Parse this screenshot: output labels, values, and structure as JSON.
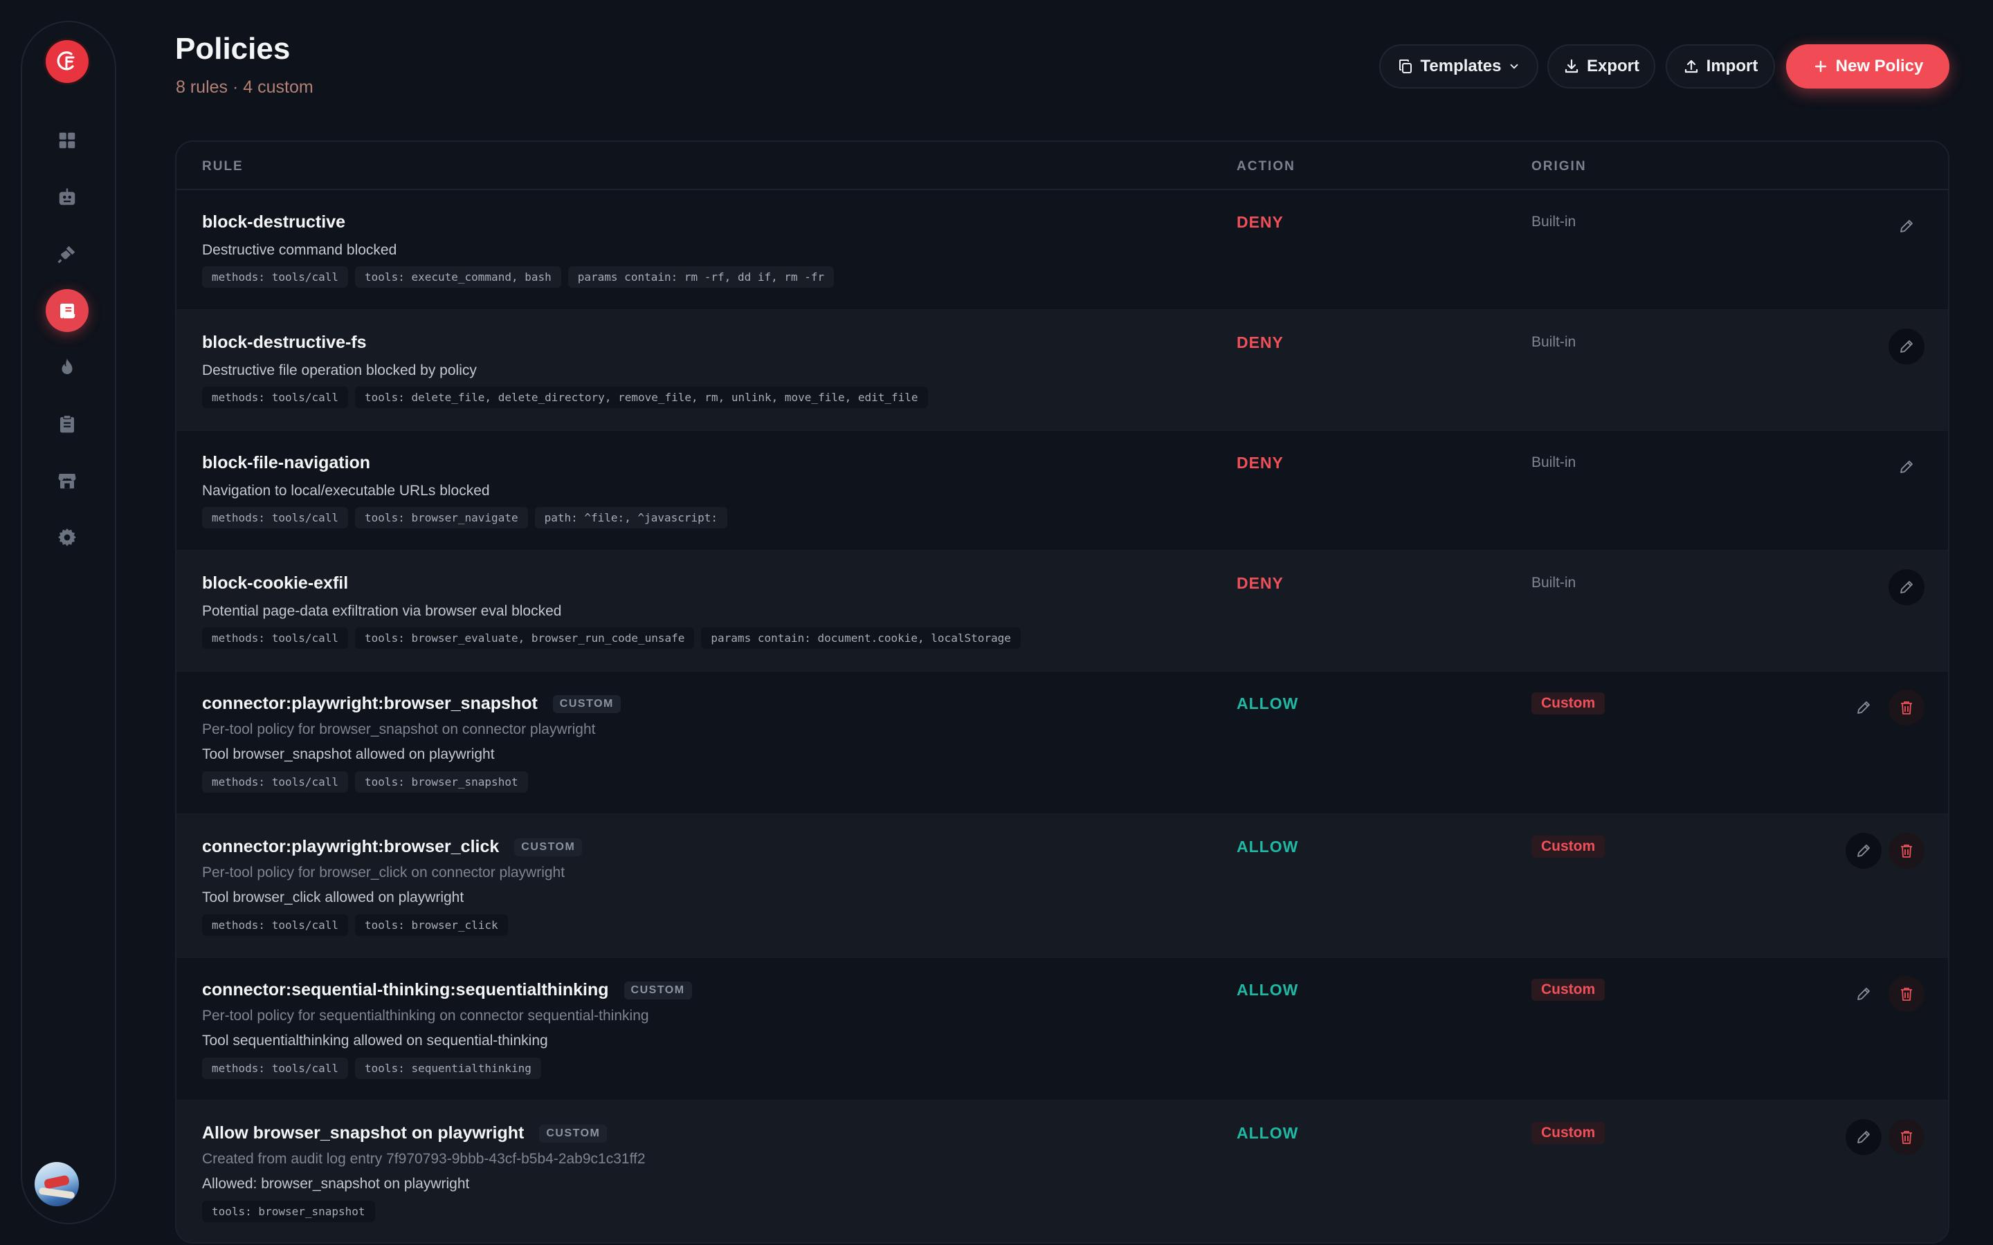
{
  "header": {
    "title": "Policies",
    "subtitle": "8 rules · 4 custom",
    "templates_label": "Templates",
    "export_label": "Export",
    "import_label": "Import",
    "new_policy_label": "New Policy"
  },
  "sidebar": {
    "items": [
      {
        "name": "dashboard",
        "icon": "grid-icon"
      },
      {
        "name": "agents",
        "icon": "robot-icon"
      },
      {
        "name": "connectors",
        "icon": "plug-icon"
      },
      {
        "name": "policies",
        "icon": "scroll-icon",
        "active": true
      },
      {
        "name": "activity",
        "icon": "flame-icon"
      },
      {
        "name": "audit",
        "icon": "clipboard-icon"
      },
      {
        "name": "store",
        "icon": "store-icon"
      },
      {
        "name": "settings",
        "icon": "gear-icon"
      }
    ]
  },
  "table": {
    "columns": {
      "rule": "RULE",
      "action": "ACTION",
      "origin": "ORIGIN"
    },
    "custom_tag": "CUSTOM",
    "rows": [
      {
        "name": "block-destructive",
        "description": "Destructive command blocked",
        "chips": [
          "methods: tools/call",
          "tools: execute_command, bash",
          "params contain: rm -rf, dd if, rm -fr"
        ],
        "action": "DENY",
        "origin": "Built-in"
      },
      {
        "name": "block-destructive-fs",
        "description": "Destructive file operation blocked by policy",
        "chips": [
          "methods: tools/call",
          "tools: delete_file, delete_directory, remove_file, rm, unlink, move_file, edit_file"
        ],
        "action": "DENY",
        "origin": "Built-in"
      },
      {
        "name": "block-file-navigation",
        "description": "Navigation to local/executable URLs blocked",
        "chips": [
          "methods: tools/call",
          "tools: browser_navigate",
          "path: ^file:, ^javascript:"
        ],
        "action": "DENY",
        "origin": "Built-in"
      },
      {
        "name": "block-cookie-exfil",
        "description": "Potential page-data exfiltration via browser eval blocked",
        "chips": [
          "methods: tools/call",
          "tools: browser_evaluate, browser_run_code_unsafe",
          "params contain: document.cookie, localStorage"
        ],
        "action": "DENY",
        "origin": "Built-in"
      },
      {
        "name": "connector:playwright:browser_snapshot",
        "subtitle": "Per-tool policy for browser_snapshot on connector playwright",
        "description": "Tool browser_snapshot allowed on playwright",
        "chips": [
          "methods: tools/call",
          "tools: browser_snapshot"
        ],
        "action": "ALLOW",
        "origin": "Custom"
      },
      {
        "name": "connector:playwright:browser_click",
        "subtitle": "Per-tool policy for browser_click on connector playwright",
        "description": "Tool browser_click allowed on playwright",
        "chips": [
          "methods: tools/call",
          "tools: browser_click"
        ],
        "action": "ALLOW",
        "origin": "Custom"
      },
      {
        "name": "connector:sequential-thinking:sequentialthinking",
        "subtitle": "Per-tool policy for sequentialthinking on connector sequential-thinking",
        "description": "Tool sequentialthinking allowed on sequential-thinking",
        "chips": [
          "methods: tools/call",
          "tools: sequentialthinking"
        ],
        "action": "ALLOW",
        "origin": "Custom"
      },
      {
        "name": "Allow browser_snapshot on playwright",
        "subtitle": "Created from audit log entry 7f970793-9bbb-43cf-b5b4-2ab9c1c31ff2",
        "description": "Allowed: browser_snapshot on playwright",
        "chips": [
          "tools: browser_snapshot"
        ],
        "action": "ALLOW",
        "origin": "Custom"
      }
    ]
  }
}
